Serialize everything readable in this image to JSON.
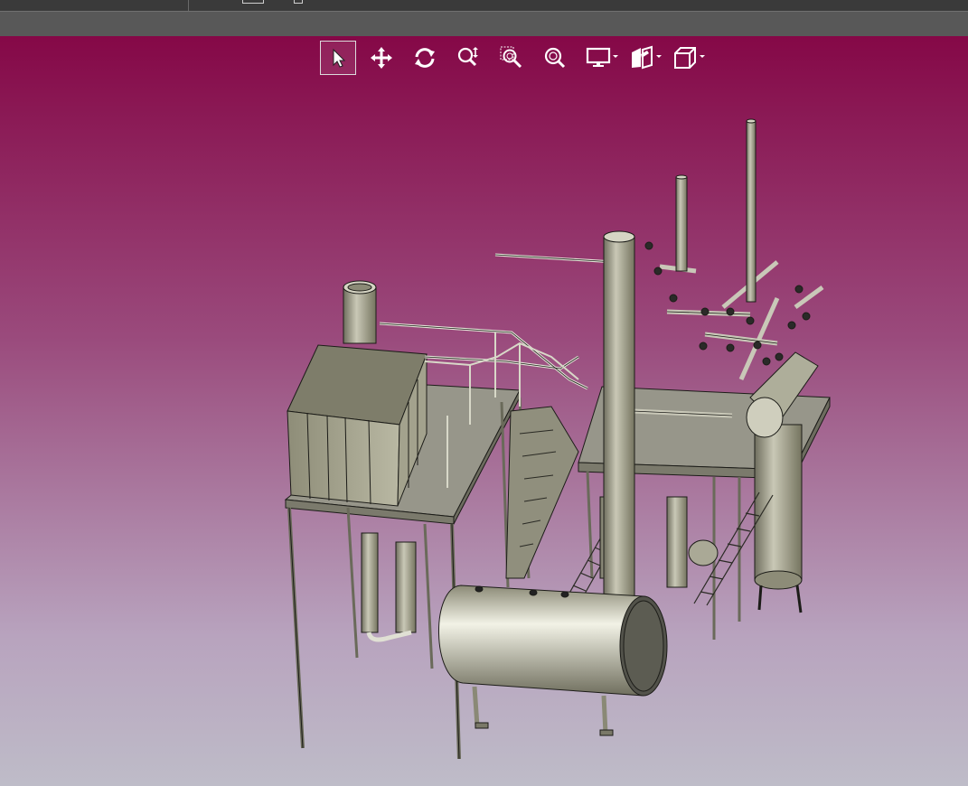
{
  "app": {
    "view_toolbar": {
      "tools": [
        {
          "name": "select-tool",
          "icon": "cursor-arrow-icon",
          "active": true
        },
        {
          "name": "pan-tool",
          "icon": "move-arrows-icon",
          "active": false
        },
        {
          "name": "rotate-tool",
          "icon": "rotate-icon",
          "active": false
        },
        {
          "name": "zoom-tool",
          "icon": "zoom-dynamic-icon",
          "active": false
        },
        {
          "name": "zoom-window-tool",
          "icon": "zoom-window-icon",
          "active": false
        },
        {
          "name": "zoom-fit-tool",
          "icon": "zoom-fit-icon",
          "active": false
        },
        {
          "name": "display-mode-dropdown",
          "icon": "monitor-icon",
          "has_dropdown": true
        },
        {
          "name": "section-view-dropdown",
          "icon": "section-icon",
          "has_dropdown": true
        },
        {
          "name": "view-orientation-dropdown",
          "icon": "cube-icon",
          "has_dropdown": true
        }
      ]
    },
    "viewport": {
      "background_top": "#850847",
      "background_bottom": "#bebcc8",
      "model": "industrial-process-plant"
    }
  }
}
